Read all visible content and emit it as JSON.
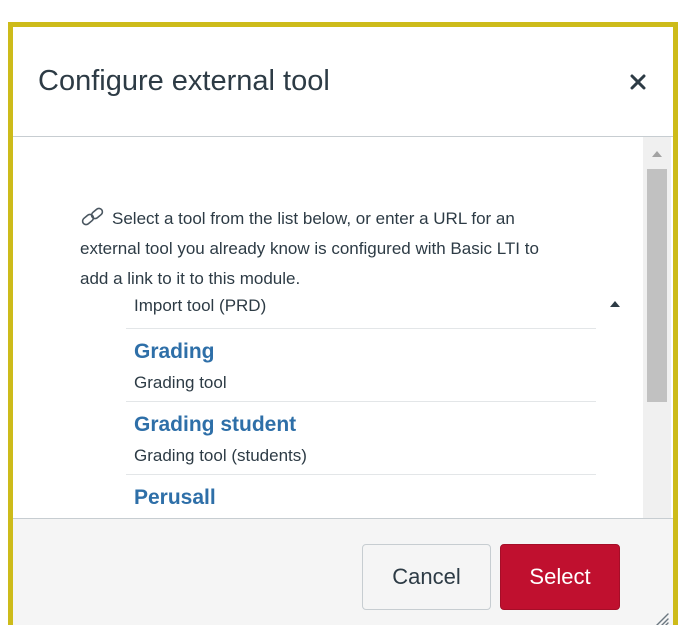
{
  "dialog": {
    "title": "Configure external tool",
    "close_icon": "close-icon",
    "intro_icon": "link-icon",
    "intro_line1": "Select a tool from the list below, or enter a URL for an",
    "intro_line2": "external tool you already know is configured with Basic LTI to",
    "intro_line3": "add a link to it to this module."
  },
  "tools": [
    {
      "name": "",
      "description": "Import tool (PRD)"
    },
    {
      "name": "Grading",
      "description": "Grading tool"
    },
    {
      "name": "Grading student",
      "description": "Grading tool (students)"
    },
    {
      "name": "Perusall",
      "description": ""
    }
  ],
  "footer": {
    "cancel_label": "Cancel",
    "select_label": "Select"
  },
  "colors": {
    "frame_border": "#cdbb1a",
    "primary_button": "#c0102f",
    "link": "#2e6fa8",
    "text": "#2d3b45"
  }
}
